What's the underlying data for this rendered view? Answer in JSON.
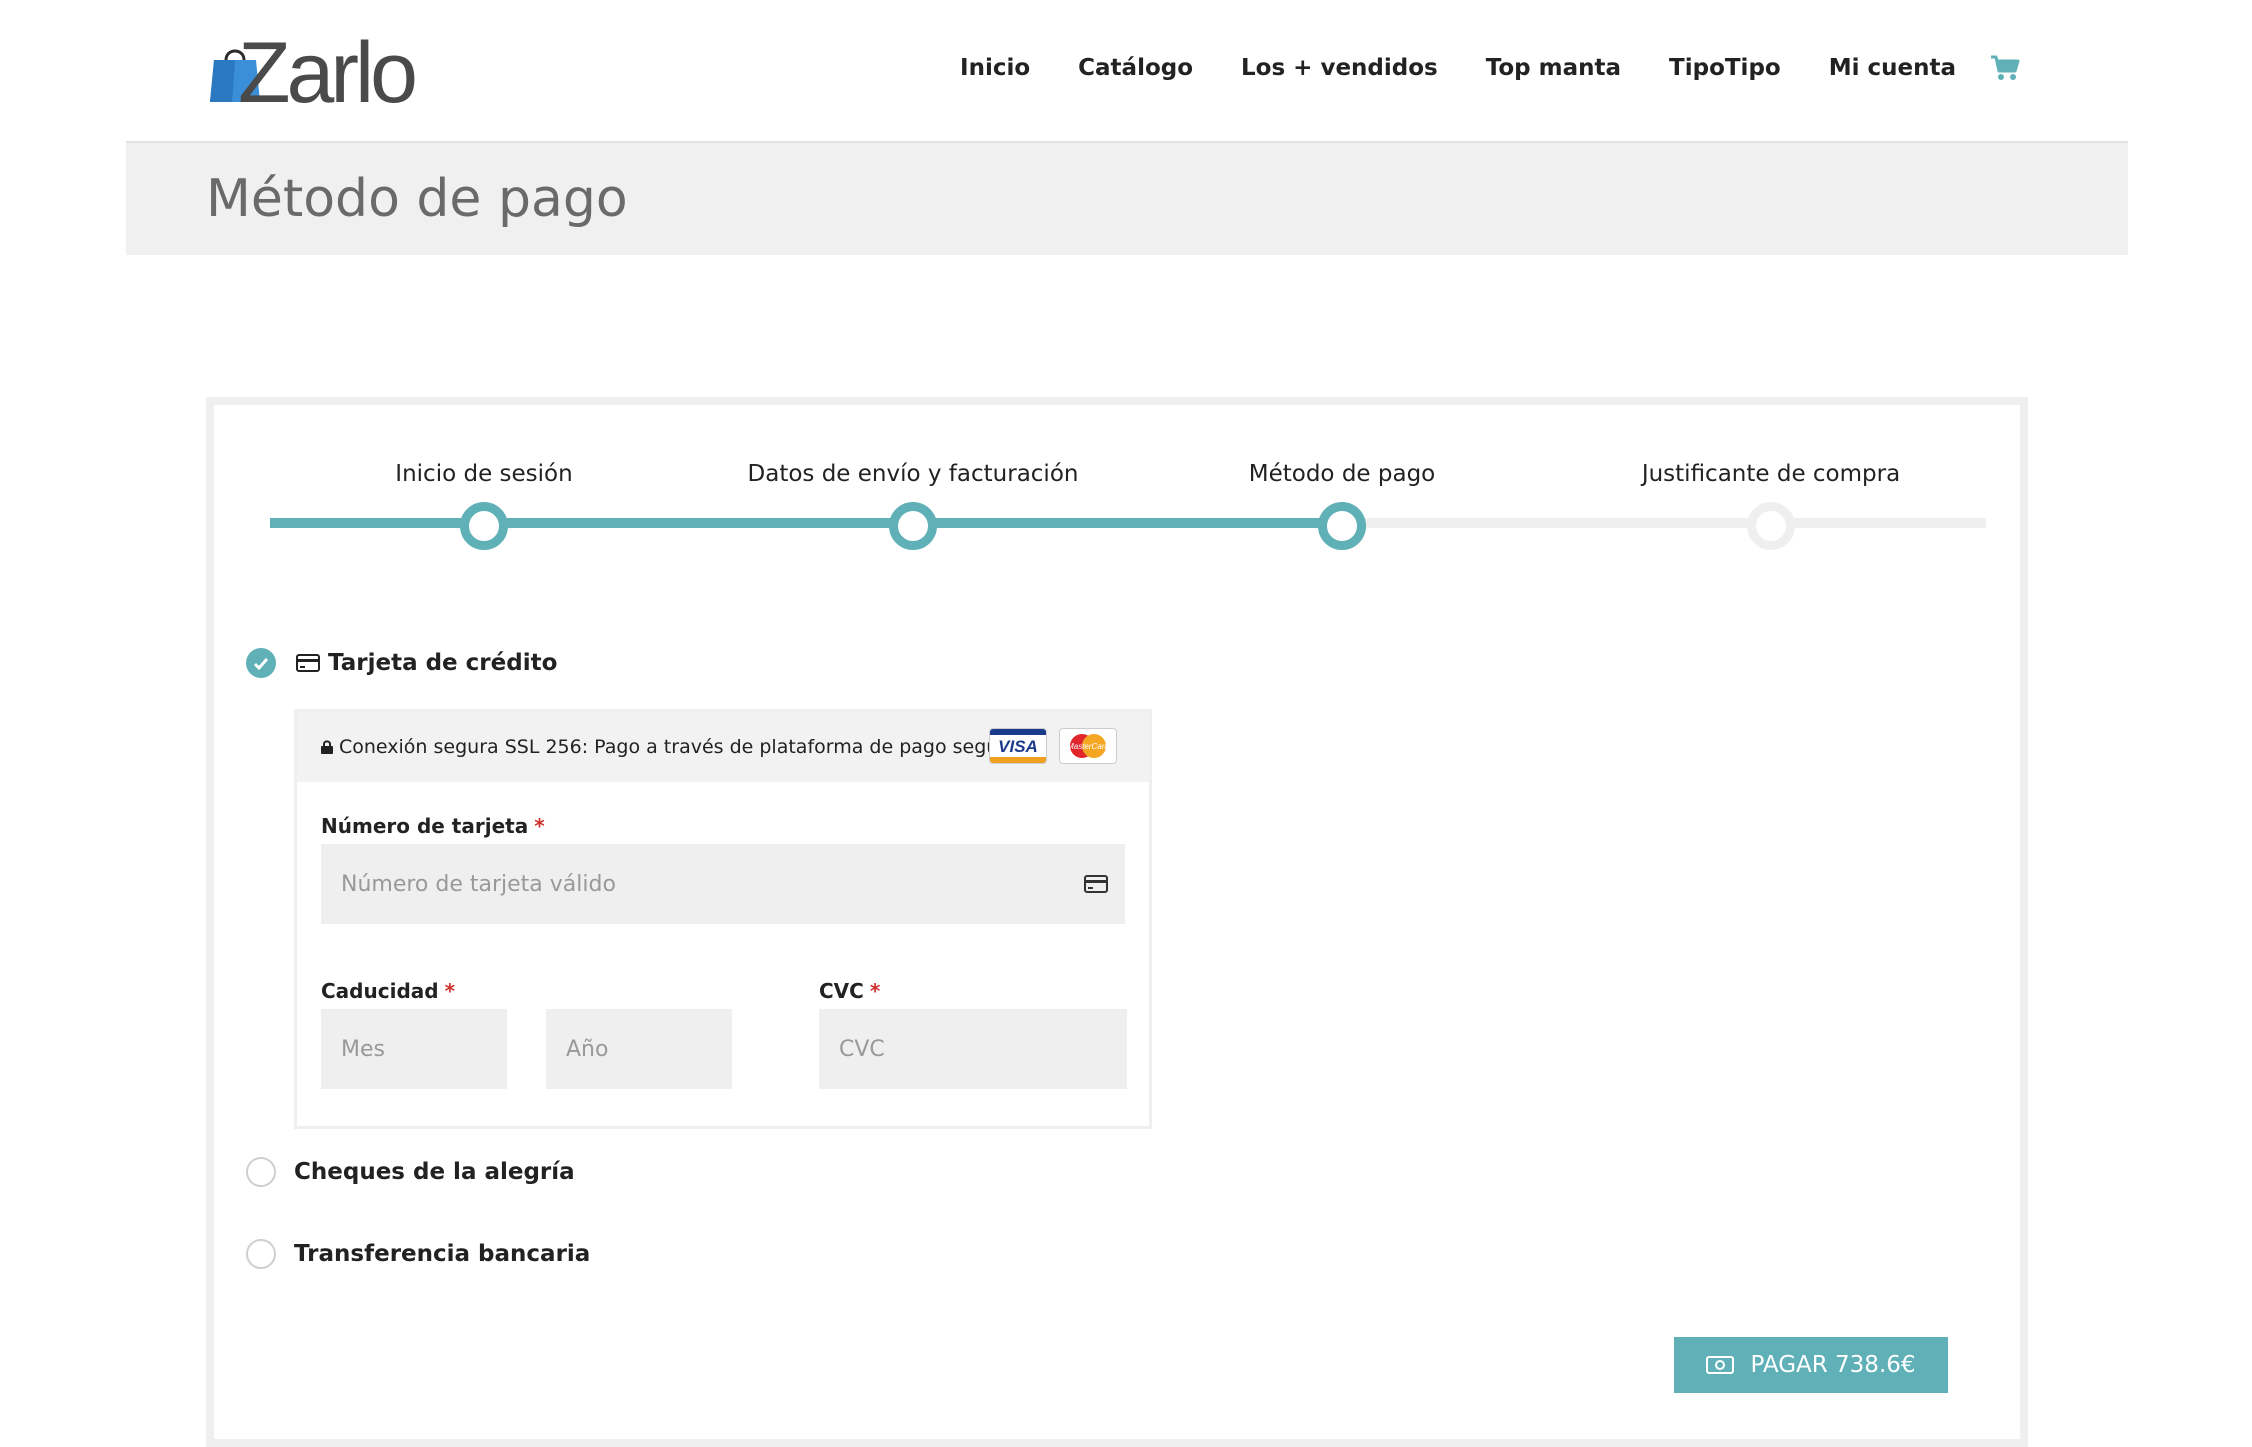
{
  "header": {
    "logo_text": "Zarlo",
    "nav": [
      "Inicio",
      "Catálogo",
      "Los + vendidos",
      "Top manta",
      "TipoTipo",
      "Mi cuenta"
    ],
    "cart_icon": "cart-icon"
  },
  "banner": {
    "title": "Método de pago"
  },
  "steps": {
    "items": [
      "Inicio de sesión",
      "Datos de envío y facturación",
      "Método de pago",
      "Justificante de compra"
    ],
    "completed_count": 3
  },
  "payment": {
    "options": [
      {
        "label": "Tarjeta de crédito",
        "selected": true
      },
      {
        "label": "Cheques de la alegría",
        "selected": false
      },
      {
        "label": "Transferencia bancaria",
        "selected": false
      }
    ],
    "secure_text": "Conexión segura SSL 256: Pago a través de plataforma de pago segura",
    "visa_label": "VISA",
    "mastercard_label": "MasterCard",
    "card_number": {
      "label": "Número de tarjeta",
      "required": "*",
      "placeholder": "Número de tarjeta válido"
    },
    "expiry": {
      "label": "Caducidad",
      "required": "*",
      "month_placeholder": "Mes",
      "year_placeholder": "Año"
    },
    "cvc": {
      "label": "CVC",
      "required": "*",
      "placeholder": "CVC"
    }
  },
  "pay_button": {
    "label": "PAGAR 738.6€"
  },
  "colors": {
    "accent": "#5fb0b7",
    "required": "#d0312d"
  }
}
